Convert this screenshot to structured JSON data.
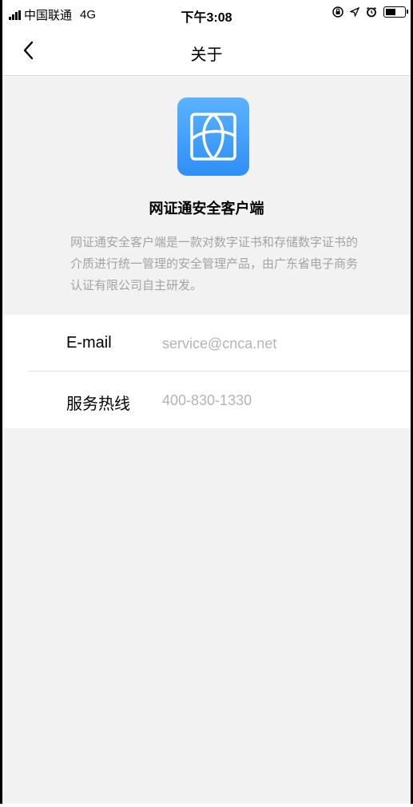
{
  "status_bar": {
    "carrier": "中国联通",
    "network": "4G",
    "time": "下午3:08",
    "battery_level": 0.6
  },
  "nav": {
    "title": "关于",
    "back_icon": "chevron-left-icon"
  },
  "about": {
    "app_name": "网证通安全客户端",
    "description": "网证通安全客户端是一款对数字证书和存储数字证书的介质进行统一管理的安全管理产品，由广东省电子商务认证有限公司自主研发。",
    "logo_icon": "app-logo-icon",
    "accent_color": "#3d9cfa"
  },
  "info": {
    "rows": [
      {
        "label": "E-mail",
        "value": "service@cnca.net"
      },
      {
        "label": "服务热线",
        "value": "400-830-1330"
      }
    ]
  }
}
